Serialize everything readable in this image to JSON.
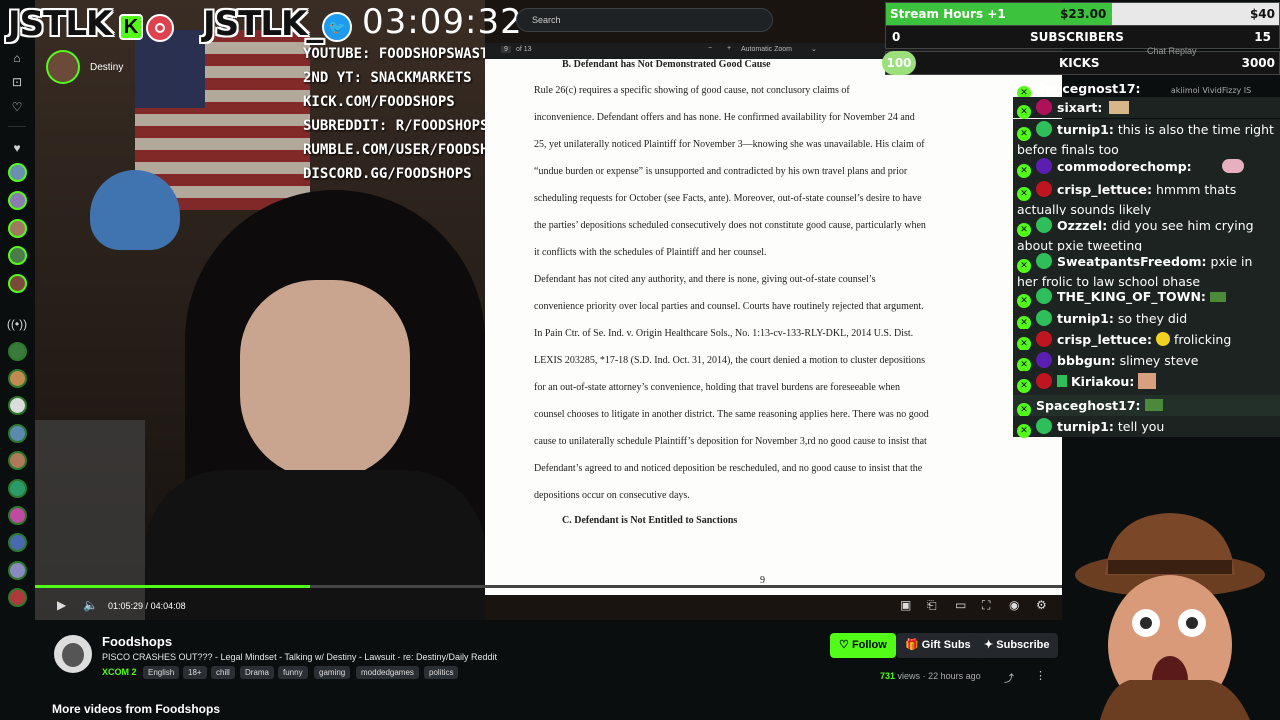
{
  "overlay": {
    "brand_left": "JSTLK",
    "k_badge": "K",
    "brand_right": "JSTLK_",
    "clock": "03:09:32",
    "social_links": [
      "YOUTUBE: FOODSHOPSWASTAKEN",
      "2ND YT: SNACKMARKETS",
      "KICK.COM/FOODSHOPS",
      "SUBREDDIT: R/FOODSHOPS",
      "RUMBLE.COM/USER/FOODSHOPS",
      "DISCORD.GG/FOODSHOPS"
    ],
    "guest_name": "Destiny"
  },
  "search": {
    "placeholder": "Search"
  },
  "stats": {
    "stream_hours_label": "Stream Hours +1",
    "stream_hours_amount": "$23.00",
    "stream_hours_goal": "$40",
    "stream_hours_progress": 0.575,
    "subs_current": "0",
    "subs_label": "SUBSCRIBERS",
    "subs_goal": "15",
    "kicks_current": "100",
    "kicks_label": "KICKS",
    "kicks_goal": "3000",
    "chat_replay": "Chat Replay"
  },
  "pdf": {
    "toolbar_page": "9",
    "toolbar_of": "of 13",
    "toolbar_zoom": "Automatic Zoom",
    "heading": "B.   Defendant has Not Demonstrated Good Cause",
    "lines": [
      "        Rule 26(c) requires a specific showing of good cause, not conclusory claims of",
      "inconvenience. Defendant offers and has none. He confirmed availability for November 24 and",
      "25, yet unilaterally noticed Plaintiff for November 3—knowing she was unavailable. His claim of",
      "“undue burden or expense” is unsupported and contradicted by his own travel plans and prior",
      "scheduling requests for October (see Facts, ante). Moreover, out-of-state counsel’s desire to have",
      "the parties’ depositions scheduled consecutively does not constitute good cause, particularly when",
      "it conflicts with the schedules of Plaintiff and her counsel.",
      "        Defendant has not cited any authority, and there is none, giving out-of-state counsel’s",
      "convenience priority over local parties and counsel. Courts have routinely rejected that argument.",
      "In Pain Ctr. of Se. Ind. v. Origin Healthcare Sols., No. 1:13-cv-133-RLY-DKL, 2014 U.S. Dist.",
      "LEXIS 203285, *17-18 (S.D. Ind. Oct. 31, 2014), the court denied a motion to cluster depositions",
      "for an out-of-state attorney’s convenience, holding that travel burdens are foreseeable when",
      "counsel chooses to litigate in another district. The same reasoning applies here. There was no good",
      "cause to unilaterally schedule Plaintiff’s deposition for November 3,rd no good cause to insist that",
      "Defendant’s agreed to and noticed deposition be rescheduled, and no good cause to insist that the",
      "depositions occur on consecutive days."
    ],
    "subheading": "C.     Defendant is Not Entitled to Sanctions",
    "page_number": "9"
  },
  "player": {
    "current_time": "01:05:29",
    "total_time": "04:04:08",
    "progress": 0.268
  },
  "chat": {
    "partial_top_name": "Spacegnost17:",
    "partial_top_extra": "akiimoi  VividFizzy  IS",
    "messages": [
      {
        "user": "sixart:",
        "text": "",
        "color": "#b0105a"
      },
      {
        "user": "turnip1:",
        "text": "this is also the time right before finals too",
        "color": "#2fbf5a"
      },
      {
        "user": "commodorechomp:",
        "text": "",
        "color": "#5a1fb0"
      },
      {
        "user": "crisp_lettuce:",
        "text": "hmmm thats actually sounds likely",
        "color": "#c0141e"
      },
      {
        "user": "Ozzzel:",
        "text": "did you see him crying about pxie tweeting",
        "color": "#2fbf5a"
      },
      {
        "user": "SweatpantsFreedom:",
        "text": "pxie in her frolic to law school phase",
        "color": "#2fbf5a"
      },
      {
        "user": "THE_KING_OF_TOWN:",
        "text": "",
        "color": "#2fbf5a"
      },
      {
        "user": "turnip1:",
        "text": "so they did",
        "color": "#2fbf5a"
      },
      {
        "user": "crisp_lettuce:",
        "text": "frolicking",
        "color": "#c0141e"
      },
      {
        "user": "bbbgun:",
        "text": "slimey steve",
        "color": "#5a1fb0"
      },
      {
        "user": "Kiriakou:",
        "text": "",
        "color": "#c0141e"
      },
      {
        "user": "Spaceghost17:",
        "text": "",
        "color": "#2fbf5a"
      },
      {
        "user": "turnip1:",
        "text": "tell you",
        "color": "#2fbf5a"
      }
    ]
  },
  "channel": {
    "name": "Foodshops",
    "title": "PISCO CRASHES OUT??? - Legal Mindset - Talking w/ Destiny - Lawsuit - re: Destiny/Daily Reddit",
    "category": "XCOM 2",
    "tags": [
      "English",
      "18+",
      "chill",
      "Drama",
      "funny",
      "gaming",
      "moddedgames",
      "politics"
    ],
    "follow": "Follow",
    "gift_subs": "Gift Subs",
    "subscribe": "Subscribe",
    "views_count": "731",
    "views_label": "views",
    "time_ago": "22 hours ago",
    "more_videos": "More videos from Foodshops"
  },
  "colors": {
    "accent": "#53fc18",
    "background": "#0b0e0f"
  }
}
